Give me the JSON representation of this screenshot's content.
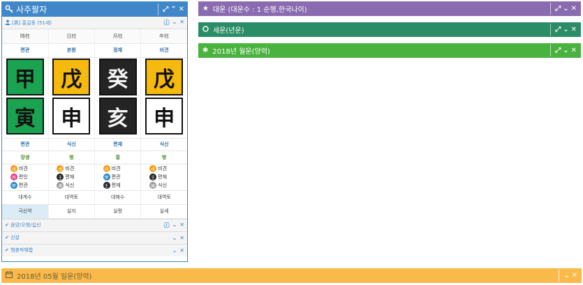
{
  "main_panel": {
    "title": "사주팔자",
    "subject_label": "[男] 홍길동 (51세)",
    "columns": [
      "時柱",
      "日柱",
      "月柱",
      "年柱"
    ],
    "heavenly_gods": [
      "편관",
      "본원",
      "정재",
      "비견"
    ],
    "heavenly_stems": [
      "甲",
      "戊",
      "癸",
      "戊"
    ],
    "earthly_branches": [
      "寅",
      "申",
      "亥",
      "申"
    ],
    "branch_gods": [
      "편관",
      "식신",
      "편재",
      "식신"
    ],
    "twelve_stages": [
      "장생",
      "병",
      "절",
      "병"
    ],
    "hidden_stems": [
      [
        {
          "char": "戊",
          "label": "비견"
        },
        {
          "char": "丙",
          "label": "편인"
        },
        {
          "char": "甲",
          "label": "편관"
        }
      ],
      [
        {
          "char": "戊",
          "label": "비견"
        },
        {
          "char": "壬",
          "label": "편재"
        },
        {
          "char": "庚",
          "label": "식신"
        }
      ],
      [
        {
          "char": "戊",
          "label": "비견"
        },
        {
          "char": "甲",
          "label": "편관"
        },
        {
          "char": "壬",
          "label": "편재"
        }
      ],
      [
        {
          "char": "戊",
          "label": "비견"
        },
        {
          "char": "壬",
          "label": "편재"
        },
        {
          "char": "庚",
          "label": "식신"
        }
      ]
    ],
    "bottom_row": [
      "대계수",
      "대역토",
      "대해수",
      "대역토"
    ],
    "last_row": [
      "극신약",
      "실지",
      "실령",
      "실세"
    ],
    "sections": [
      "음양/오행/십신",
      "신살",
      "형충파해합"
    ]
  },
  "daeun_bar": {
    "title": "대운 (대운수 : 1 순행,한국나이)"
  },
  "seun_bar": {
    "title": "세운(년운)"
  },
  "wolun_bar": {
    "title": "2018년 월운(양력)"
  },
  "ilun_bar": {
    "title": "2018년 05월 일운(양력)"
  },
  "icons": {
    "main": "key-icon",
    "subject": "user-icon",
    "daeun": "star-icon",
    "seun": "circle-icon",
    "wolun": "asterisk-icon",
    "ilun": "calendar-icon"
  },
  "colors": {
    "main_header": "#3f87c8",
    "daeun": "#8a6bb0",
    "seun": "#2a8d67",
    "wolun": "#4ab23e",
    "ilun": "#f9ba49",
    "wood": "#1aa350",
    "earth": "#f6b90e",
    "water": "#242424",
    "metal": "#ffffff"
  }
}
